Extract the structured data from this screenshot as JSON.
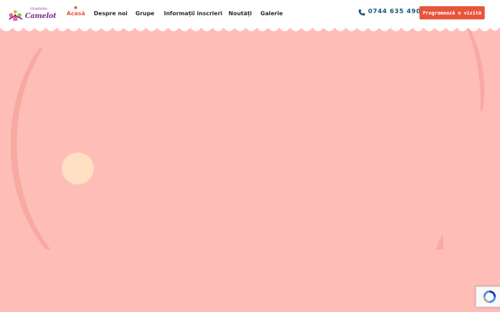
{
  "site": {
    "logo_small_text": "Gradinita",
    "logo_text": "Camelot"
  },
  "nav": {
    "items": [
      {
        "label": "Acasă",
        "active": true
      },
      {
        "label": "Despre noi",
        "active": false
      },
      {
        "label": "Grupe",
        "active": false
      },
      {
        "label": "Informații inscrieri",
        "active": false
      },
      {
        "label": "Noutăți",
        "active": false
      },
      {
        "label": "Galerie",
        "active": false
      }
    ]
  },
  "header": {
    "phone": "0744 635 490",
    "cta_label": "Programează o vizită"
  },
  "colors": {
    "background": "#ffbdb8",
    "accent": "#e8553a",
    "phone": "#175873",
    "circle": "#ffe0c2",
    "arc": "#f7a9a2"
  },
  "icons": {
    "phone": "phone-icon",
    "recaptcha": "recaptcha-icon",
    "logo": "logo-icon"
  }
}
